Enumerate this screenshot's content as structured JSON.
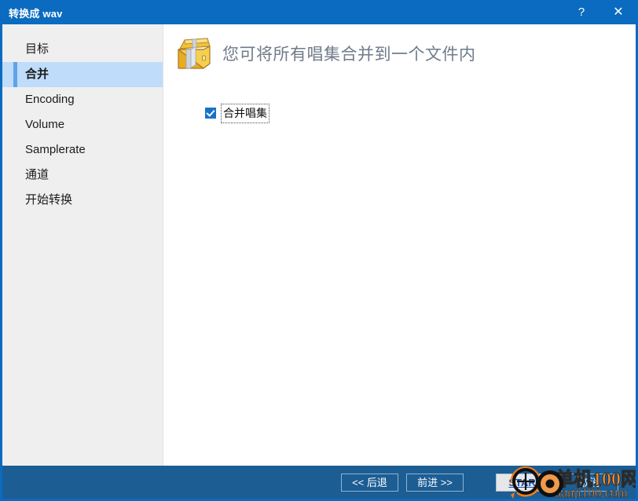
{
  "window": {
    "title": "转换成 wav",
    "help_label": "?",
    "close_label": "✕"
  },
  "sidebar": {
    "items": [
      {
        "label": "目标",
        "selected": false
      },
      {
        "label": "合并",
        "selected": true
      },
      {
        "label": "Encoding",
        "selected": false
      },
      {
        "label": "Volume",
        "selected": false
      },
      {
        "label": "Samplerate",
        "selected": false
      },
      {
        "label": "通道",
        "selected": false
      },
      {
        "label": "开始转换",
        "selected": false
      }
    ]
  },
  "content": {
    "header_title": "您可将所有唱集合并到一个文件内",
    "header_icon": "treasure-chest-icon",
    "merge_checkbox": {
      "label": "合并唱集",
      "checked": true
    }
  },
  "footer": {
    "back_label": "<< 后退",
    "next_label": "前进 >>",
    "start_label": "START",
    "cancel_label": "取消"
  },
  "watermark": {
    "line1": "单机100网",
    "line2": "danji100.com"
  },
  "colors": {
    "titlebar": "#0a6bc0",
    "footer": "#1c5d93",
    "sidebar": "#efefef",
    "selected_row": "#bfdcfa",
    "selected_accent": "#5fa3e8",
    "checkbox": "#1673c8",
    "header_text": "#6f7b8a",
    "watermark": "#f08b32",
    "start_text": "#1a4fb0"
  }
}
